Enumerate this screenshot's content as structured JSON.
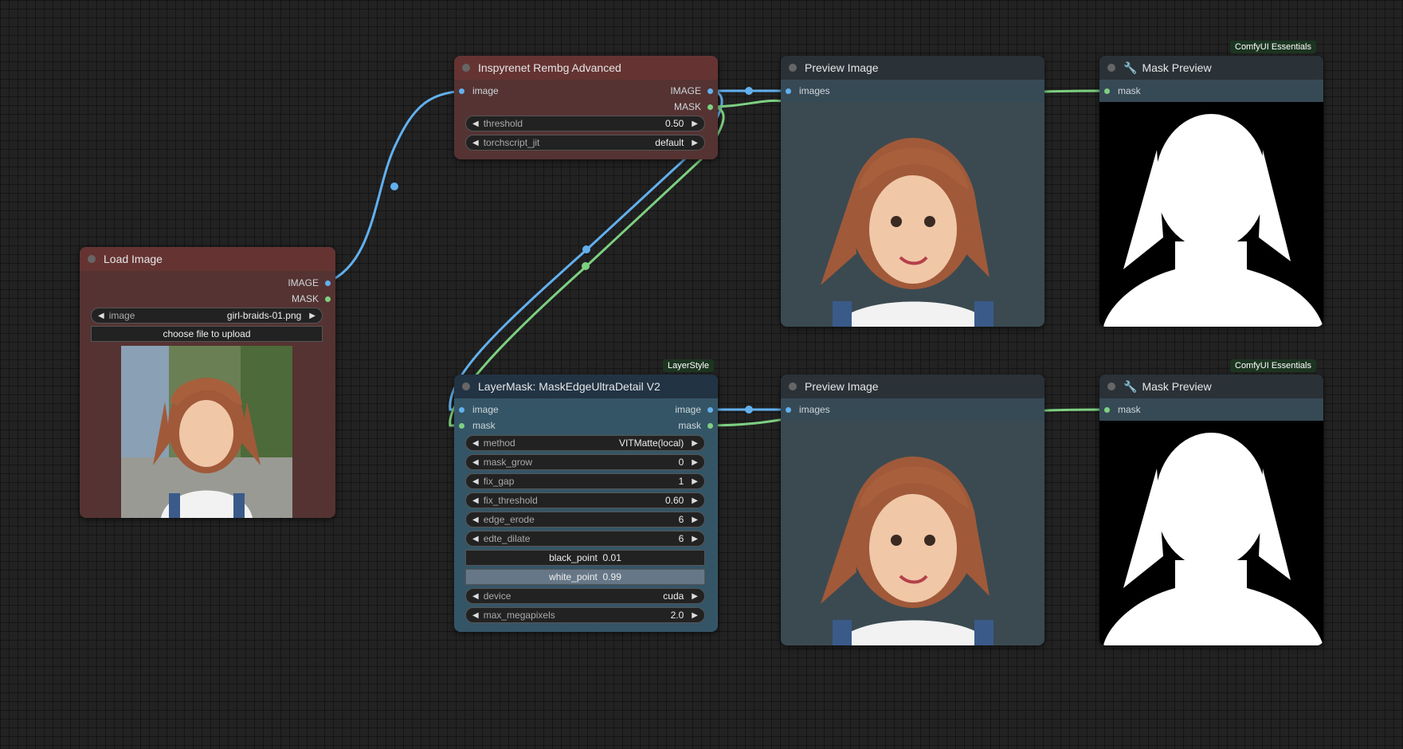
{
  "colors": {
    "image_link": "#62b0ee",
    "mask_link": "#7dd081",
    "canvas_bg": "#222222"
  },
  "load_image": {
    "title": "Load Image",
    "outputs": [
      "IMAGE",
      "MASK"
    ],
    "widget_label": "image",
    "widget_value": "girl-braids-01.png",
    "upload_label": "choose file to upload"
  },
  "inspyrenet": {
    "title": "Inspyrenet Rembg Advanced",
    "input": "image",
    "outputs": [
      "IMAGE",
      "MASK"
    ],
    "widgets": [
      {
        "label": "threshold",
        "value": "0.50"
      },
      {
        "label": "torchscript_jit",
        "value": "default"
      }
    ]
  },
  "layermask": {
    "badge": "LayerStyle",
    "title": "LayerMask: MaskEdgeUltraDetail V2",
    "inputs": [
      "image",
      "mask"
    ],
    "outputs": [
      "image",
      "mask"
    ],
    "widgets": [
      {
        "label": "method",
        "value": "VITMatte(local)"
      },
      {
        "label": "mask_grow",
        "value": "0"
      },
      {
        "label": "fix_gap",
        "value": "1"
      },
      {
        "label": "fix_threshold",
        "value": "0.60"
      },
      {
        "label": "edge_erode",
        "value": "6"
      },
      {
        "label": "edte_dilate",
        "value": "6"
      }
    ],
    "black_point": {
      "label": "black_point",
      "value": "0.01"
    },
    "white_point": {
      "label": "white_point",
      "value": "0.99"
    },
    "widgets2": [
      {
        "label": "device",
        "value": "cuda"
      },
      {
        "label": "max_megapixels",
        "value": "2.0"
      }
    ]
  },
  "preview_top": {
    "title": "Preview Image",
    "input": "images"
  },
  "preview_bottom": {
    "title": "Preview Image",
    "input": "images"
  },
  "mask_top": {
    "badge": "ComfyUI Essentials",
    "title": "Mask Preview",
    "input": "mask",
    "icon": "wrench-icon"
  },
  "mask_bottom": {
    "badge": "ComfyUI Essentials",
    "title": "Mask Preview",
    "input": "mask",
    "icon": "wrench-icon"
  }
}
